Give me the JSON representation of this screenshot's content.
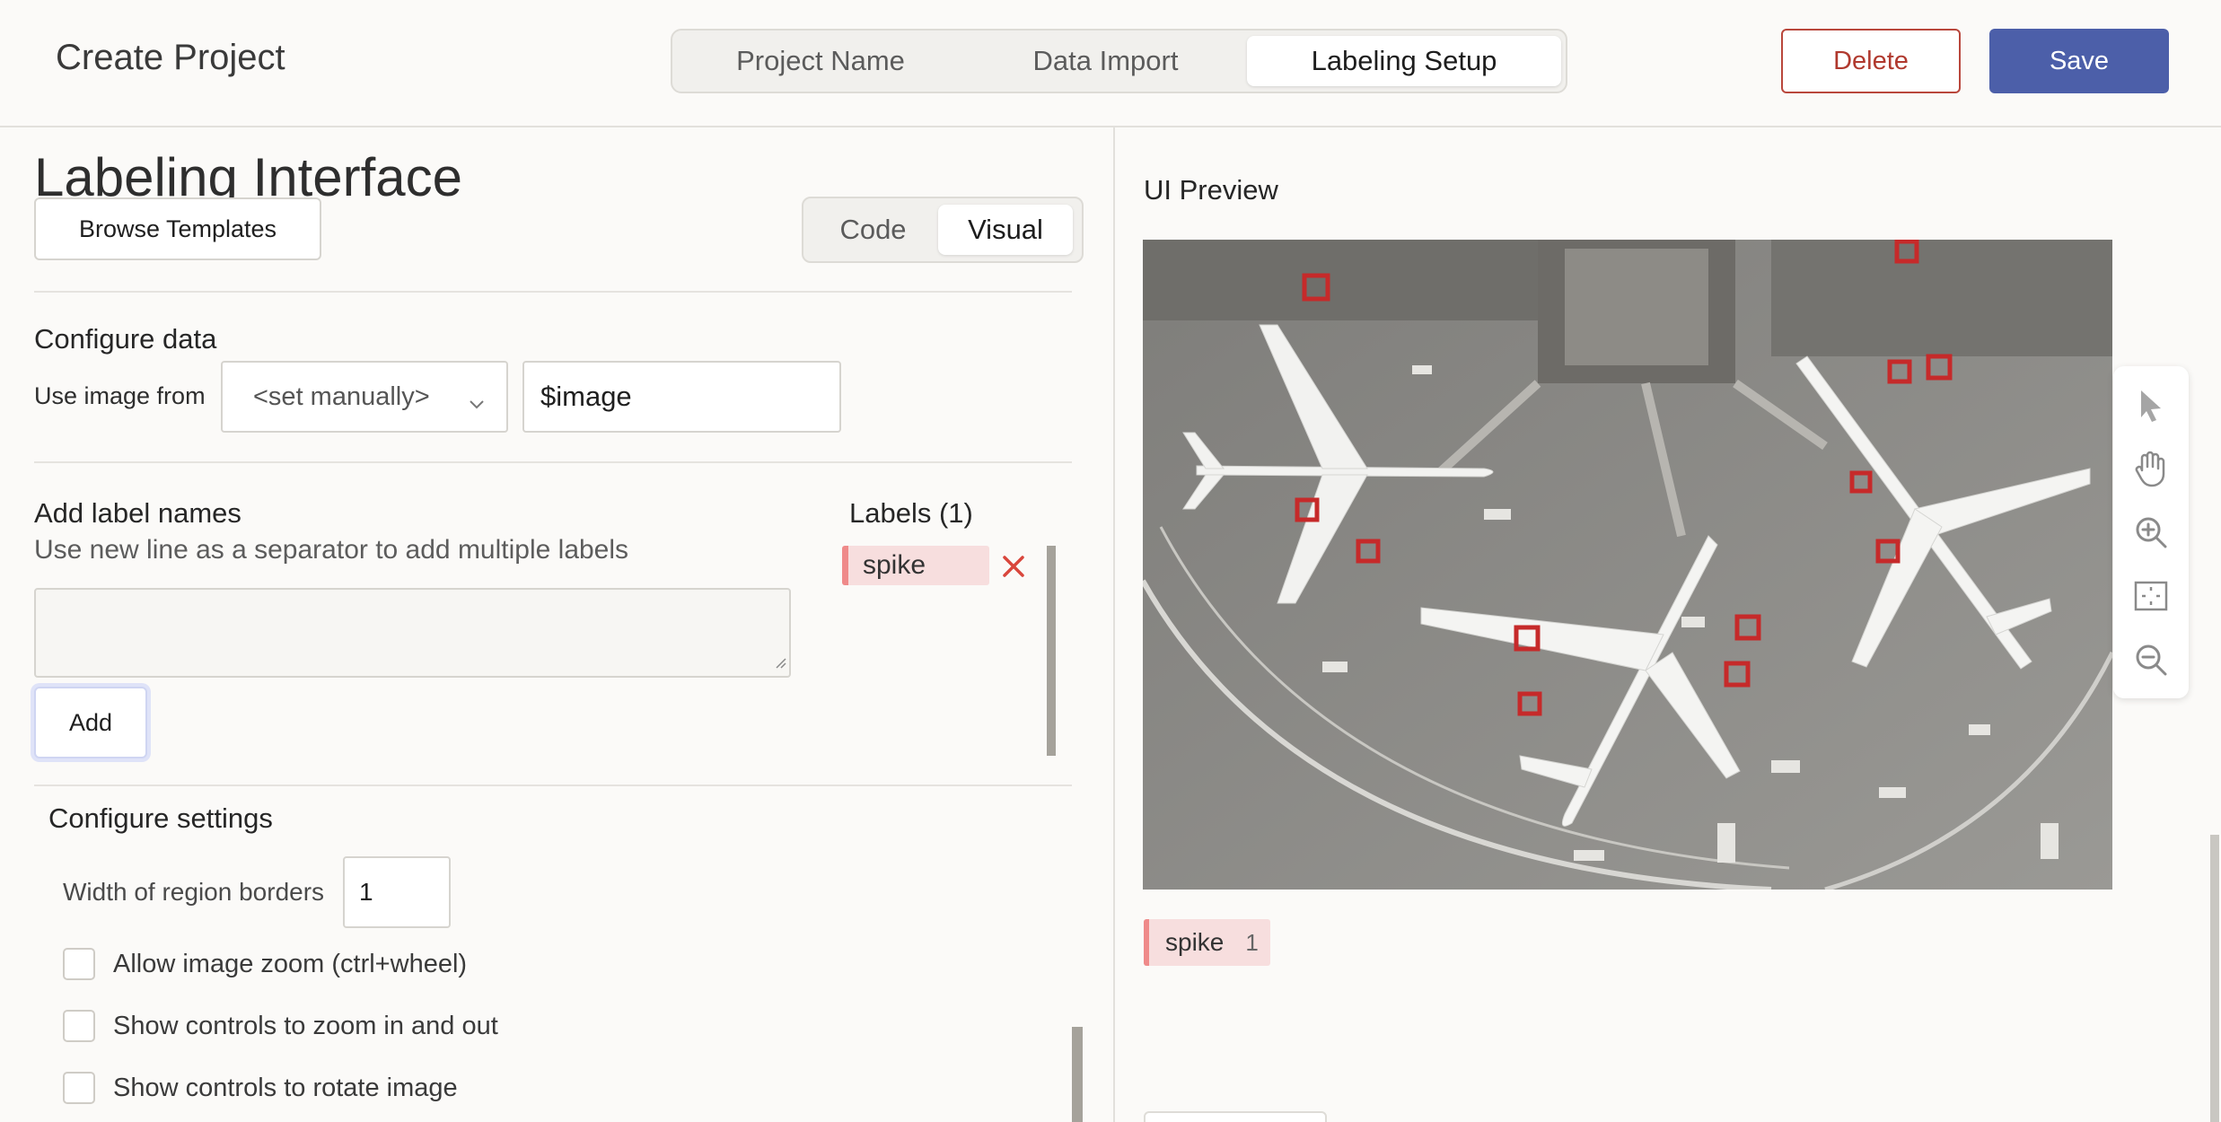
{
  "header": {
    "title": "Create Project",
    "steps": [
      "Project Name",
      "Data Import",
      "Labeling Setup"
    ],
    "active_step": "Labeling Setup",
    "delete_label": "Delete",
    "save_label": "Save"
  },
  "left": {
    "section_title": "Labeling Interface",
    "browse_label": "Browse Templates",
    "view_toggle": {
      "code": "Code",
      "visual": "Visual",
      "active": "Visual"
    },
    "configure_data": {
      "title": "Configure data",
      "use_image_label": "Use image from",
      "select_value": "<set manually>",
      "input_value": "$image"
    },
    "add_labels": {
      "title": "Add label names",
      "hint": "Use new line as a separator to add multiple labels",
      "textarea_value": "",
      "add_label": "Add"
    },
    "labels": {
      "title": "Labels (1)",
      "items": [
        {
          "name": "spike",
          "color": "#ef8a8a"
        }
      ]
    },
    "settings": {
      "title": "Configure settings",
      "width_label": "Width of region borders",
      "width_value": "1",
      "checkboxes": [
        {
          "label": "Allow image zoom (ctrl+wheel)",
          "checked": false
        },
        {
          "label": "Show controls to zoom in and out",
          "checked": false
        },
        {
          "label": "Show controls to rotate image",
          "checked": false
        }
      ]
    }
  },
  "right": {
    "preview_title": "UI Preview",
    "toolbar_icons": [
      "pointer-icon",
      "hand-icon",
      "zoom-in-icon",
      "fit-icon",
      "zoom-out-icon"
    ],
    "result_label": {
      "name": "spike",
      "count": "1",
      "color": "#ef8a8a"
    }
  },
  "colors": {
    "accent": "#4c5fa9",
    "danger": "#b0392e",
    "label_bg": "#f7dede"
  }
}
